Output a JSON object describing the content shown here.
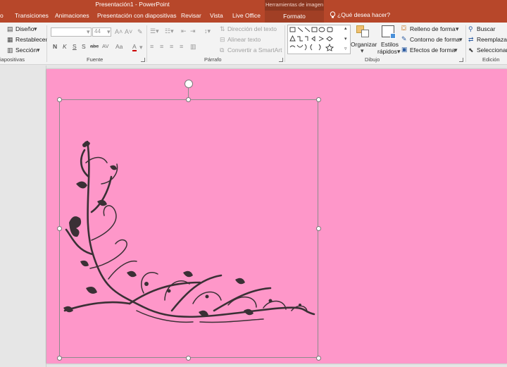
{
  "window": {
    "title": "Presentación1 - PowerPoint",
    "context_header": "Herramientas de imagen"
  },
  "tabs": {
    "partial": "o",
    "transiciones": "Transiciones",
    "animaciones": "Animaciones",
    "presentacion": "Presentación con diapositivas",
    "revisar": "Revisar",
    "vista": "Vista",
    "live_office": "Live Office",
    "formato": "Formato",
    "tell_me": "¿Qué desea hacer?"
  },
  "ribbon": {
    "diapositivas": {
      "diseno": "Diseño",
      "restablecer": "Restablecer",
      "seccion": "Sección",
      "label": "iapositivas"
    },
    "fuente": {
      "font_name": "",
      "font_size": "44",
      "label": "Fuente",
      "bold": "N",
      "italic": "K",
      "underline": "S",
      "shadow": "S",
      "strike": "abc",
      "spacing": "AV",
      "case": "Aa",
      "color": "A"
    },
    "parrafo": {
      "direccion": "Dirección del texto",
      "alinear": "Alinear texto",
      "convertir": "Convertir a SmartArt",
      "label": "Párrafo"
    },
    "dibujo": {
      "organizar": "Organizar",
      "estilos": "Estilos",
      "rapidos": "rápidos",
      "relleno": "Relleno de forma",
      "contorno": "Contorno de forma",
      "efectos": "Efectos de forma",
      "label": "Dibujo"
    },
    "edicion": {
      "buscar": "Buscar",
      "reemplazar": "Reemplazar",
      "seleccionar": "Seleccionar",
      "label": "Edición"
    }
  },
  "slide": {
    "background_color": "#fe97c9",
    "ornament_color": "#3a3035"
  },
  "colors": {
    "accent": "#b7472a",
    "context_tab": "#a13f25"
  }
}
